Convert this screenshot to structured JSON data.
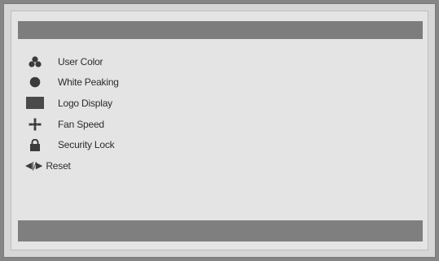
{
  "osd": {
    "menu_items": [
      {
        "label": "User Color",
        "icon": "palette-icon",
        "icon_glyph": "",
        "interactable": true
      },
      {
        "label": "White Peaking",
        "icon": "circle-icon",
        "icon_glyph": "",
        "interactable": true
      },
      {
        "label": "Logo Display",
        "icon": "display-icon",
        "icon_glyph": "",
        "interactable": true
      },
      {
        "label": "Fan Speed",
        "icon": "fan-icon",
        "icon_glyph": "",
        "interactable": true
      },
      {
        "label": "Security Lock",
        "icon": "lock-icon",
        "icon_glyph": "",
        "interactable": true
      },
      {
        "label": "Reset",
        "icon": "reset-icon",
        "icon_glyph": "◀|/▶",
        "interactable": true
      }
    ]
  },
  "colors": {
    "background": "#858585",
    "panel": "#e4e4e4",
    "bar": "#7d7d7d",
    "text": "#2c2c2c"
  }
}
